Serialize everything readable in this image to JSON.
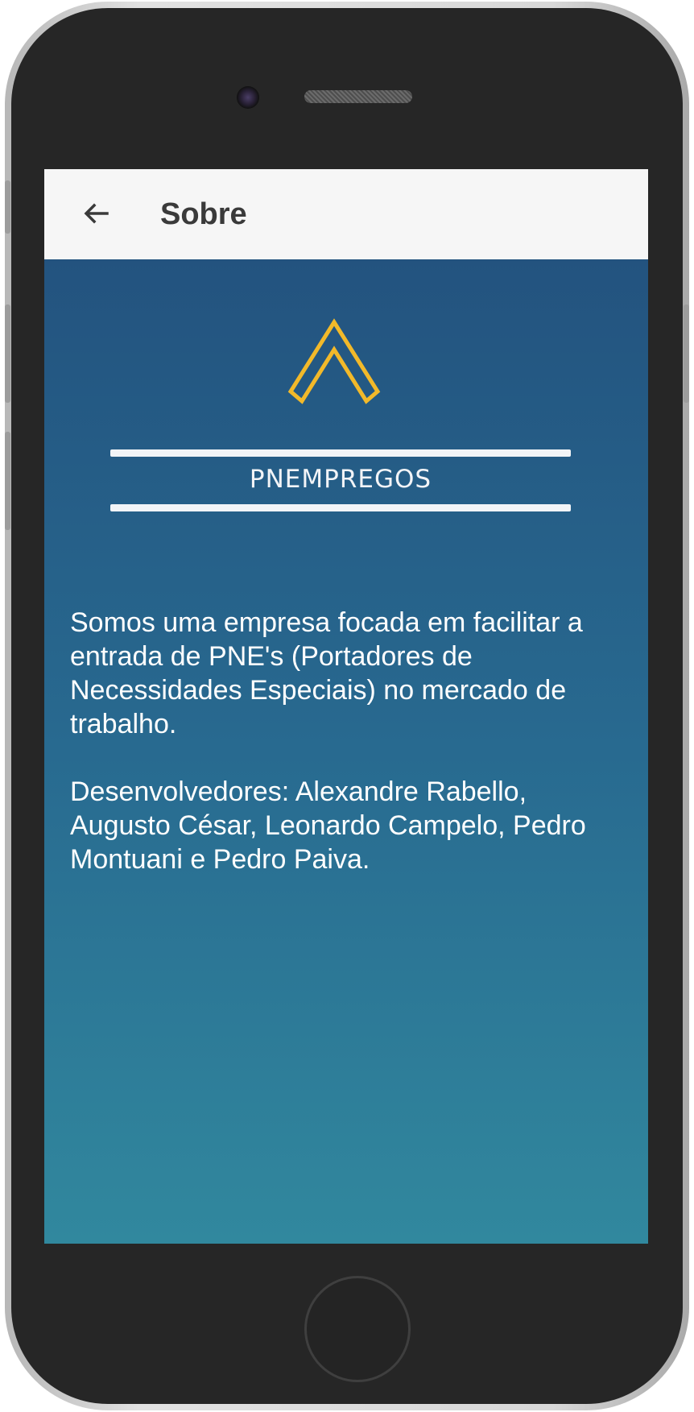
{
  "appbar": {
    "title": "Sobre",
    "back_icon": "arrow-back-icon"
  },
  "logo": {
    "text": "PNEMPREGOS",
    "mark_icon": "chevron-up-icon",
    "mark_color": "#f2b92a",
    "line_color": "#f2f4f7"
  },
  "content": {
    "about": "Somos uma empresa focada em facilitar a entrada de PNE's (Portadores de Necessidades Especiais) no mercado de trabalho.",
    "developers": "Desenvolvedores: Alexandre Rabello, Augusto César, Leonardo Campelo, Pedro Montuani e Pedro Paiva."
  },
  "colors": {
    "appbar_bg": "#f6f6f6",
    "content_gradient_top": "#23537f",
    "content_gradient_bottom": "#31889e",
    "text": "#ffffff"
  }
}
